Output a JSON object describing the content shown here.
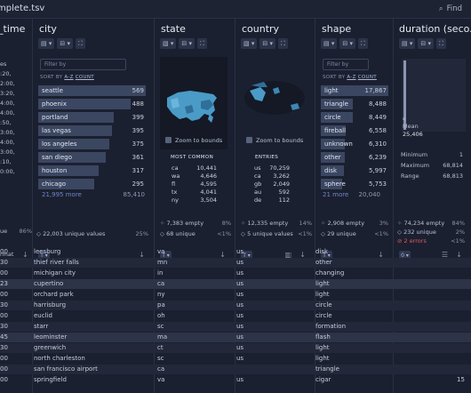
{
  "window": {
    "title": "mplete.tsv",
    "find_label": "Find"
  },
  "columns": [
    {
      "name": "_time",
      "unique_label": "ue",
      "unique_pct": "86%",
      "format_label": "rmat"
    },
    {
      "name": "city"
    },
    {
      "name": "state"
    },
    {
      "name": "country"
    },
    {
      "name": "shape"
    },
    {
      "name": "duration (seco..."
    }
  ],
  "time_col": {
    "partial_values": [
      "es",
      ":20,",
      "2:00,",
      "3:20,",
      "4:00,",
      "4:00,",
      ":50,",
      "3:00,",
      "4:00,",
      "3:00,",
      ":10,",
      "0:00,"
    ]
  },
  "city": {
    "filter_placeholder": "Filter by",
    "sort_prefix": "SORT BY",
    "sort_az": "A-Z",
    "sort_count": "COUNT",
    "bars": [
      {
        "label": "seattle",
        "value": "569",
        "frac": 1.0
      },
      {
        "label": "phoenix",
        "value": "488",
        "frac": 0.86
      },
      {
        "label": "portland",
        "value": "399",
        "frac": 0.7
      },
      {
        "label": "las vegas",
        "value": "395",
        "frac": 0.69
      },
      {
        "label": "los angeles",
        "value": "375",
        "frac": 0.66
      },
      {
        "label": "san diego",
        "value": "361",
        "frac": 0.63
      },
      {
        "label": "houston",
        "value": "317",
        "frac": 0.56
      },
      {
        "label": "chicago",
        "value": "295",
        "frac": 0.52
      }
    ],
    "more_label": "21,995 more",
    "more_value": "85,410",
    "unique_values": "22,003 unique values",
    "unique_pct": "25%"
  },
  "state": {
    "zoom_label": "Zoom to bounds",
    "most_common_header": "MOST COMMON",
    "most_common": [
      {
        "k": "ca",
        "v": "10,441"
      },
      {
        "k": "wa",
        "v": "4,646"
      },
      {
        "k": "fl",
        "v": "4,595"
      },
      {
        "k": "tx",
        "v": "4,041"
      },
      {
        "k": "ny",
        "v": "3,504"
      }
    ],
    "empty": "7,383 empty",
    "empty_pct": "8%",
    "unique": "68 unique",
    "unique_pct": "<1%"
  },
  "country": {
    "zoom_label": "Zoom to bounds",
    "entries_header": "ENTRIES",
    "entries": [
      {
        "k": "us",
        "v": "70,259"
      },
      {
        "k": "ca",
        "v": "3,262"
      },
      {
        "k": "gb",
        "v": "2,049"
      },
      {
        "k": "au",
        "v": "592"
      },
      {
        "k": "de",
        "v": "112"
      }
    ],
    "empty": "12,335 empty",
    "empty_pct": "14%",
    "unique": "5 unique values",
    "unique_pct": "<1%"
  },
  "shape": {
    "filter_placeholder": "Filter by",
    "sort_prefix": "SORT BY",
    "sort_az": "A-Z",
    "sort_count": "COUNT",
    "bars": [
      {
        "label": "light",
        "value": "17,867",
        "frac": 1.0
      },
      {
        "label": "triangle",
        "value": "8,488",
        "frac": 0.48
      },
      {
        "label": "circle",
        "value": "8,449",
        "frac": 0.47
      },
      {
        "label": "fireball",
        "value": "6,558",
        "frac": 0.37
      },
      {
        "label": "unknown",
        "value": "6,310",
        "frac": 0.35
      },
      {
        "label": "other",
        "value": "6,239",
        "frac": 0.35
      },
      {
        "label": "disk",
        "value": "5,997",
        "frac": 0.34
      },
      {
        "label": "sphere",
        "value": "5,753",
        "frac": 0.32
      }
    ],
    "more_label": "21 more",
    "more_value": "20,040",
    "empty": "2,908 empty",
    "empty_pct": "3%",
    "unique": "29 unique",
    "unique_pct": "<1%"
  },
  "duration": {
    "mean_label": "Mean",
    "mean_value": "25,406",
    "tick_label": "a",
    "stats": [
      {
        "k": "Minimum",
        "v": "1"
      },
      {
        "k": "Maximum",
        "v": "68,814"
      },
      {
        "k": "Range",
        "v": "68,813"
      }
    ],
    "empty": "74,234 empty",
    "empty_pct": "84%",
    "unique": "232 unique",
    "unique_pct": "2%",
    "errors": "2 errors",
    "errors_pct": "<1%"
  },
  "rows": [
    {
      "t": "00",
      "city": "leesburg",
      "state": "va",
      "country": "us",
      "shape": "disk",
      "dur": ""
    },
    {
      "t": "30",
      "city": "thief river falls",
      "state": "mn",
      "country": "us",
      "shape": "other",
      "dur": ""
    },
    {
      "t": "00",
      "city": "michigan city",
      "state": "in",
      "country": "us",
      "shape": "changing",
      "dur": ""
    },
    {
      "t": "23",
      "city": "cupertino",
      "state": "ca",
      "country": "us",
      "shape": "light",
      "dur": ""
    },
    {
      "t": "00",
      "city": "orchard park",
      "state": "ny",
      "country": "us",
      "shape": "light",
      "dur": ""
    },
    {
      "t": "30",
      "city": "harrisburg",
      "state": "pa",
      "country": "us",
      "shape": "circle",
      "dur": ""
    },
    {
      "t": "00",
      "city": "euclid",
      "state": "oh",
      "country": "us",
      "shape": "circle",
      "dur": ""
    },
    {
      "t": "30",
      "city": "starr",
      "state": "sc",
      "country": "us",
      "shape": "formation",
      "dur": ""
    },
    {
      "t": "45",
      "city": "leominster",
      "state": "ma",
      "country": "us",
      "shape": "flash",
      "dur": ""
    },
    {
      "t": "30",
      "city": "greenwich",
      "state": "ct",
      "country": "us",
      "shape": "light",
      "dur": ""
    },
    {
      "t": "00",
      "city": "north charleston",
      "state": "sc",
      "country": "us",
      "shape": "light",
      "dur": ""
    },
    {
      "t": "00",
      "city": "san francisco airport",
      "state": "ca",
      "country": "",
      "shape": "triangle",
      "dur": ""
    },
    {
      "t": "00",
      "city": "springfield",
      "state": "va",
      "country": "us",
      "shape": "cigar",
      "dur": "15"
    }
  ]
}
